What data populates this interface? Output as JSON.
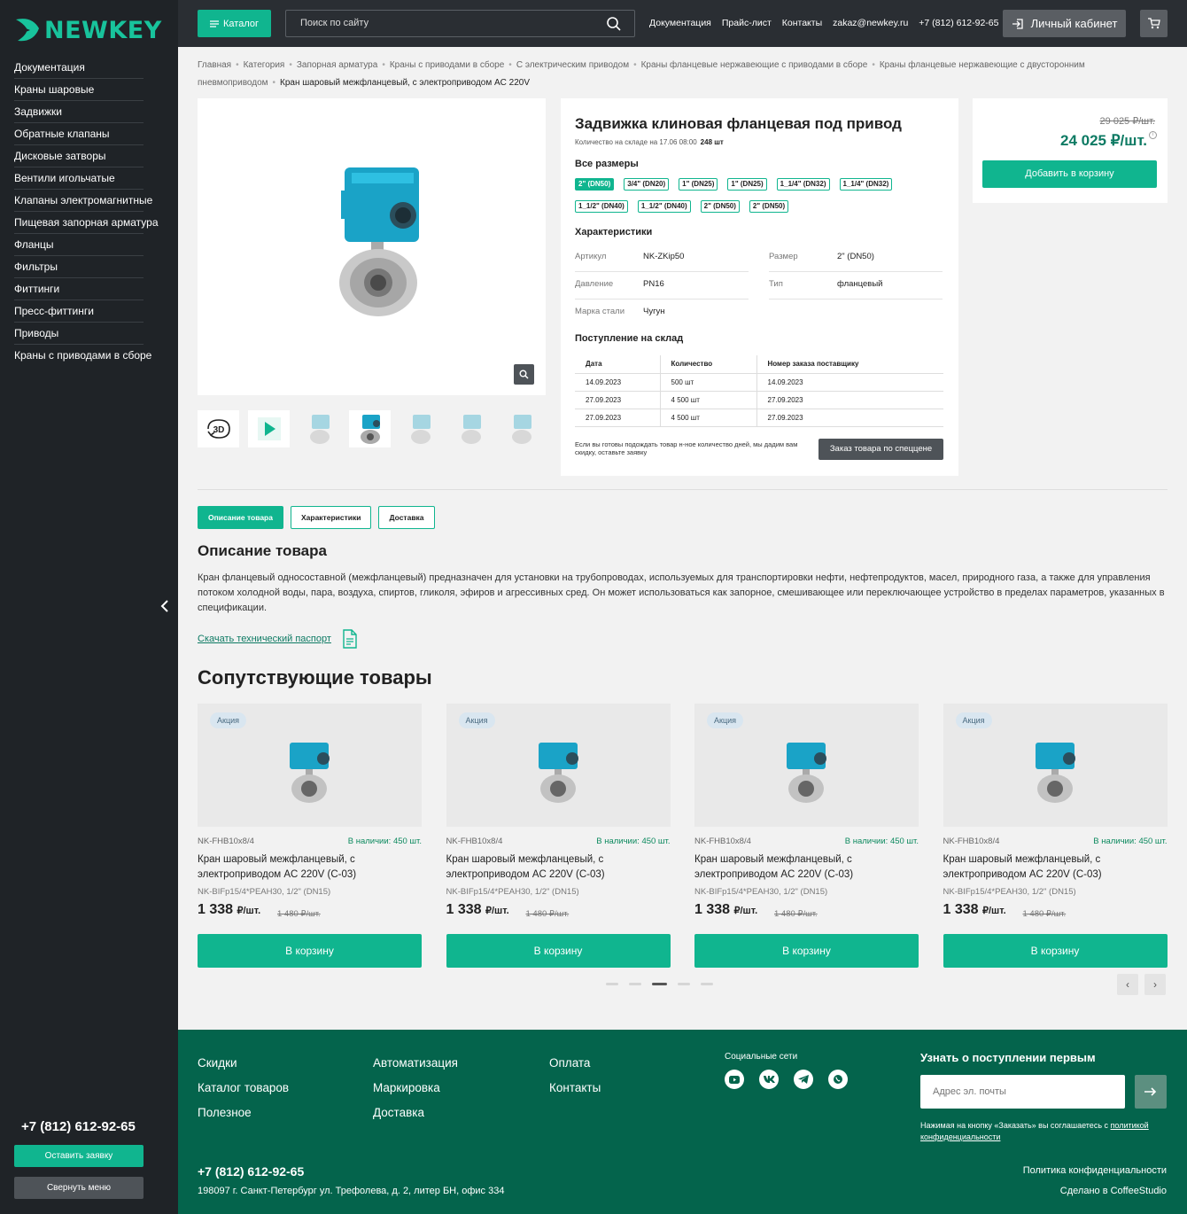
{
  "brand": {
    "name": "NEWKEY",
    "accent": "#10b58f"
  },
  "sidebar": {
    "items": [
      {
        "label": "Документация"
      },
      {
        "label": "Краны шаровые"
      },
      {
        "label": "Задвижки"
      },
      {
        "label": "Обратные клапаны"
      },
      {
        "label": "Дисковые затворы"
      },
      {
        "label": "Вентили игольчатые"
      },
      {
        "label": "Клапаны электромагнитные"
      },
      {
        "label": "Пищевая запорная арматура"
      },
      {
        "label": "Фланцы"
      },
      {
        "label": "Фильтры"
      },
      {
        "label": "Фиттинги"
      },
      {
        "label": "Пресс-фиттинги"
      },
      {
        "label": "Приводы"
      },
      {
        "label": "Краны с приводами в сборе"
      }
    ],
    "phone": "+7 (812) 612-92-65",
    "request_label": "Оставить заявку",
    "collapse_label": "Свернуть меню"
  },
  "header": {
    "catalog_label": "Каталог",
    "search_placeholder": "Поиск по сайту",
    "nav": [
      "Документация",
      "Прайс-лист",
      "Контакты",
      "zakaz@newkey.ru",
      "+7 (812) 612-92-65"
    ],
    "account_label": "Личный кабинет"
  },
  "breadcrumbs": {
    "items": [
      "Главная",
      "Категория",
      "Запорная арматура",
      "Краны с приводами в сборе",
      "С электрическим приводом",
      "Краны фланцевые нержавеющие с приводами в сборе",
      "Краны фланцевые нержавеющие с двусторонним пневмоприводом"
    ],
    "current": "Кран шаровый межфланцевый, с электроприводом AC 220V"
  },
  "product": {
    "title": "Задвижка клиновая фланцевая под привод",
    "stock_label": "Количество на складе на 17.06 08:00",
    "stock_value": "248 шт",
    "sizes_heading": "Все размеры",
    "sizes": [
      "2\" (DN50)",
      "3/4\" (DN20)",
      "1\" (DN25)",
      "1\" (DN25)",
      "1_1/4\" (DN32)",
      "1_1/4\" (DN32)",
      "1_1/2\" (DN40)",
      "1_1/2\" (DN40)",
      "2\" (DN50)",
      "2\" (DN50)"
    ],
    "active_size_index": 0,
    "chars_heading": "Характеристики",
    "chars": [
      {
        "key": "Артикул",
        "value": "NK-ZKip50"
      },
      {
        "key": "Размер",
        "value": "2\" (DN50)"
      },
      {
        "key": "Давление",
        "value": "PN16"
      },
      {
        "key": "Тип",
        "value": "фланцевый"
      },
      {
        "key": "Марка стали",
        "value": "Чугун"
      }
    ],
    "arrivals_heading": "Поступление на склад",
    "arrivals_columns": [
      "Дата",
      "Количество",
      "Номер заказа поставщику"
    ],
    "arrivals_rows": [
      [
        "14.09.2023",
        "500 шт",
        "14.09.2023"
      ],
      [
        "27.09.2023",
        "4 500 шт",
        "27.09.2023"
      ],
      [
        "27.09.2023",
        "4 500 шт",
        "27.09.2023"
      ]
    ],
    "wait_note": "Если вы готовы подождать товар н-ное количество дней, мы дадим вам скидку, оставьте заявку",
    "special_order_label": "Заказ товара по спеццене",
    "old_price": "29 025 ₽/шт.",
    "price": "24 025 ₽/шт.",
    "add_to_cart_label": "Добавить в корзину",
    "thumb_3d_label": "3D"
  },
  "tabs": [
    {
      "label": "Описание товара"
    },
    {
      "label": "Характеристики"
    },
    {
      "label": "Доставка"
    }
  ],
  "description": {
    "heading": "Описание товара",
    "text": "Кран фланцевый односоставной (межфланцевый) предназначен для установки на трубопроводах, используемых для транспортировки нефти, нефтепродуктов, масел, природного газа, а также для управления потоком холодной воды, пара, воздуха, спиртов, гликоля, эфиров и агрессивных сред. Он может использоваться как запорное, смешивающее или переключающее устройство в пределах параметров, указанных в спецификации.",
    "passport_label": "Скачать технический паспорт"
  },
  "related": {
    "heading": "Сопутствующие товары",
    "cards": [
      {
        "badge": "Акция",
        "code": "NK-FHB10x8/4",
        "stock": "В наличии: 450 шт.",
        "name": "Кран шаровый межфланцевый, с электроприводом AC 220V (С-03)",
        "sku": "NK-BIFp15/4*PEAH30, 1/2\" (DN15)",
        "price": "1 338",
        "unit": "₽/шт.",
        "old_price": "1 480 ₽/шт.",
        "button": "В корзину"
      },
      {
        "badge": "Акция",
        "code": "NK-FHB10x8/4",
        "stock": "В наличии: 450 шт.",
        "name": "Кран шаровый межфланцевый, с электроприводом AC 220V (С-03)",
        "sku": "NK-BIFp15/4*PEAH30, 1/2\" (DN15)",
        "price": "1 338",
        "unit": "₽/шт.",
        "old_price": "1 480 ₽/шт.",
        "button": "В корзину"
      },
      {
        "badge": "Акция",
        "code": "NK-FHB10x8/4",
        "stock": "В наличии: 450 шт.",
        "name": "Кран шаровый межфланцевый, с электроприводом AC 220V (С-03)",
        "sku": "NK-BIFp15/4*PEAH30, 1/2\" (DN15)",
        "price": "1 338",
        "unit": "₽/шт.",
        "old_price": "1 480 ₽/шт.",
        "button": "В корзину"
      },
      {
        "badge": "Акция",
        "code": "NK-FHB10x8/4",
        "stock": "В наличии: 450 шт.",
        "name": "Кран шаровый межфланцевый, с электроприводом AC 220V (С-03)",
        "sku": "NK-BIFp15/4*PEAH30, 1/2\" (DN15)",
        "price": "1 338",
        "unit": "₽/шт.",
        "old_price": "1 480 ₽/шт.",
        "button": "В корзину"
      }
    ],
    "active_page_index": 2,
    "page_count": 5
  },
  "footer": {
    "col1": [
      "Скидки",
      "Каталог товаров",
      "Полезное"
    ],
    "col2": [
      "Автоматизация",
      "Маркировка",
      "Доставка"
    ],
    "col3": [
      "Оплата",
      "Контакты"
    ],
    "social_heading": "Социальные сети",
    "socials": [
      "youtube-icon",
      "vk-icon",
      "telegram-icon",
      "whatsapp-icon"
    ],
    "subscribe_heading": "Узнать о поступлении первым",
    "email_placeholder": "Адрес эл. почты",
    "consent_text": "Нажимая на кнопку «Заказать» вы соглашаетесь с",
    "consent_link": "политикой конфиденциальности",
    "phone": "+7 (812) 612-92-65",
    "address": "198097 г. Санкт-Петербург ул. Трефолева, д. 2, литер БН, офис 334",
    "policy_label": "Политика конфиденциальности",
    "made_by": "Сделано в CoffeeStudio",
    "bg_color": "#04644c"
  }
}
